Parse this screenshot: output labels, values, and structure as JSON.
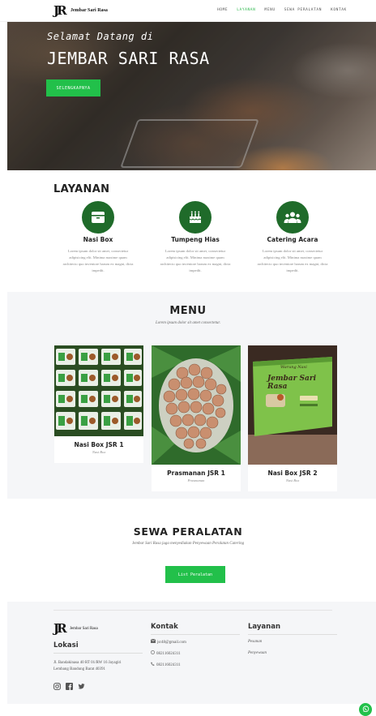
{
  "nav": {
    "brand_mark": "JR",
    "brand_text": "Jembar Sari Rasa",
    "items": [
      {
        "label": "Home",
        "active": false
      },
      {
        "label": "Layanan",
        "active": true
      },
      {
        "label": "Menu",
        "active": false
      },
      {
        "label": "Sewa Peralatan",
        "active": false
      },
      {
        "label": "Kontak",
        "active": false
      }
    ]
  },
  "hero": {
    "welcome": "Selamat Datang di",
    "title": "JEMBAR SARI RASA",
    "button": "Selengkapnya"
  },
  "layanan": {
    "title": "LAYANAN",
    "items": [
      {
        "name": "Nasi Box",
        "icon": "box-icon",
        "desc": "Lorem ipsum dolor sit amet, consectetur adipisicing elit. Minima maxime quam architecto quo inventore harum ex magni, dicta impedit."
      },
      {
        "name": "Tumpeng Hias",
        "icon": "cake-icon",
        "desc": "Lorem ipsum dolor sit amet, consectetur adipisicing elit. Minima maxime quam architecto quo inventore harum ex magni, dicta impedit."
      },
      {
        "name": "Catering Acara",
        "icon": "users-icon",
        "desc": "Lorem ipsum dolor sit amet, consectetur adipisicing elit. Minima maxime quam architecto quo inventore harum ex magni, dicta impedit."
      }
    ]
  },
  "menu": {
    "title": "MENU",
    "subtitle": "Lorem ipsum dolor sit amet consectetur.",
    "items": [
      {
        "name": "Nasi Box JSR 1",
        "category": "Nasi Box"
      },
      {
        "name": "Prasmanan JSR 1",
        "category": "Prasmanan"
      },
      {
        "name": "Nasi Box JSR 2",
        "category": "Nasi Box"
      }
    ],
    "box_label_top": "Warung Nasi",
    "box_label_name": "Jembar Sari Rasa"
  },
  "sewa": {
    "title": "SEWA PERALATAN",
    "subtitle": "Jembar Sari Rasa juga menyediakan Penyewaan Peralatan Catering",
    "button": "List Peralatan"
  },
  "footer": {
    "brand_text": "Jembar Sari Rasa",
    "lokasi_title": "Lokasi",
    "address_line1": "Jl. Bandakinasa 40 RT 01/RW 16 Jayagiri",
    "address_line2": "Lembang Bandung Barat 40391",
    "kontak_title": "Kontak",
    "email": "jsr48@gmail.com",
    "phone1": "082116024311",
    "phone2": "082116024311",
    "layanan_title": "Layanan",
    "layanan_items": [
      "Pesanan",
      "Penyewaan"
    ]
  },
  "colors": {
    "accent": "#22c04a",
    "icon_bg": "#1f6b2a",
    "section_bg": "#f5f6f8"
  }
}
